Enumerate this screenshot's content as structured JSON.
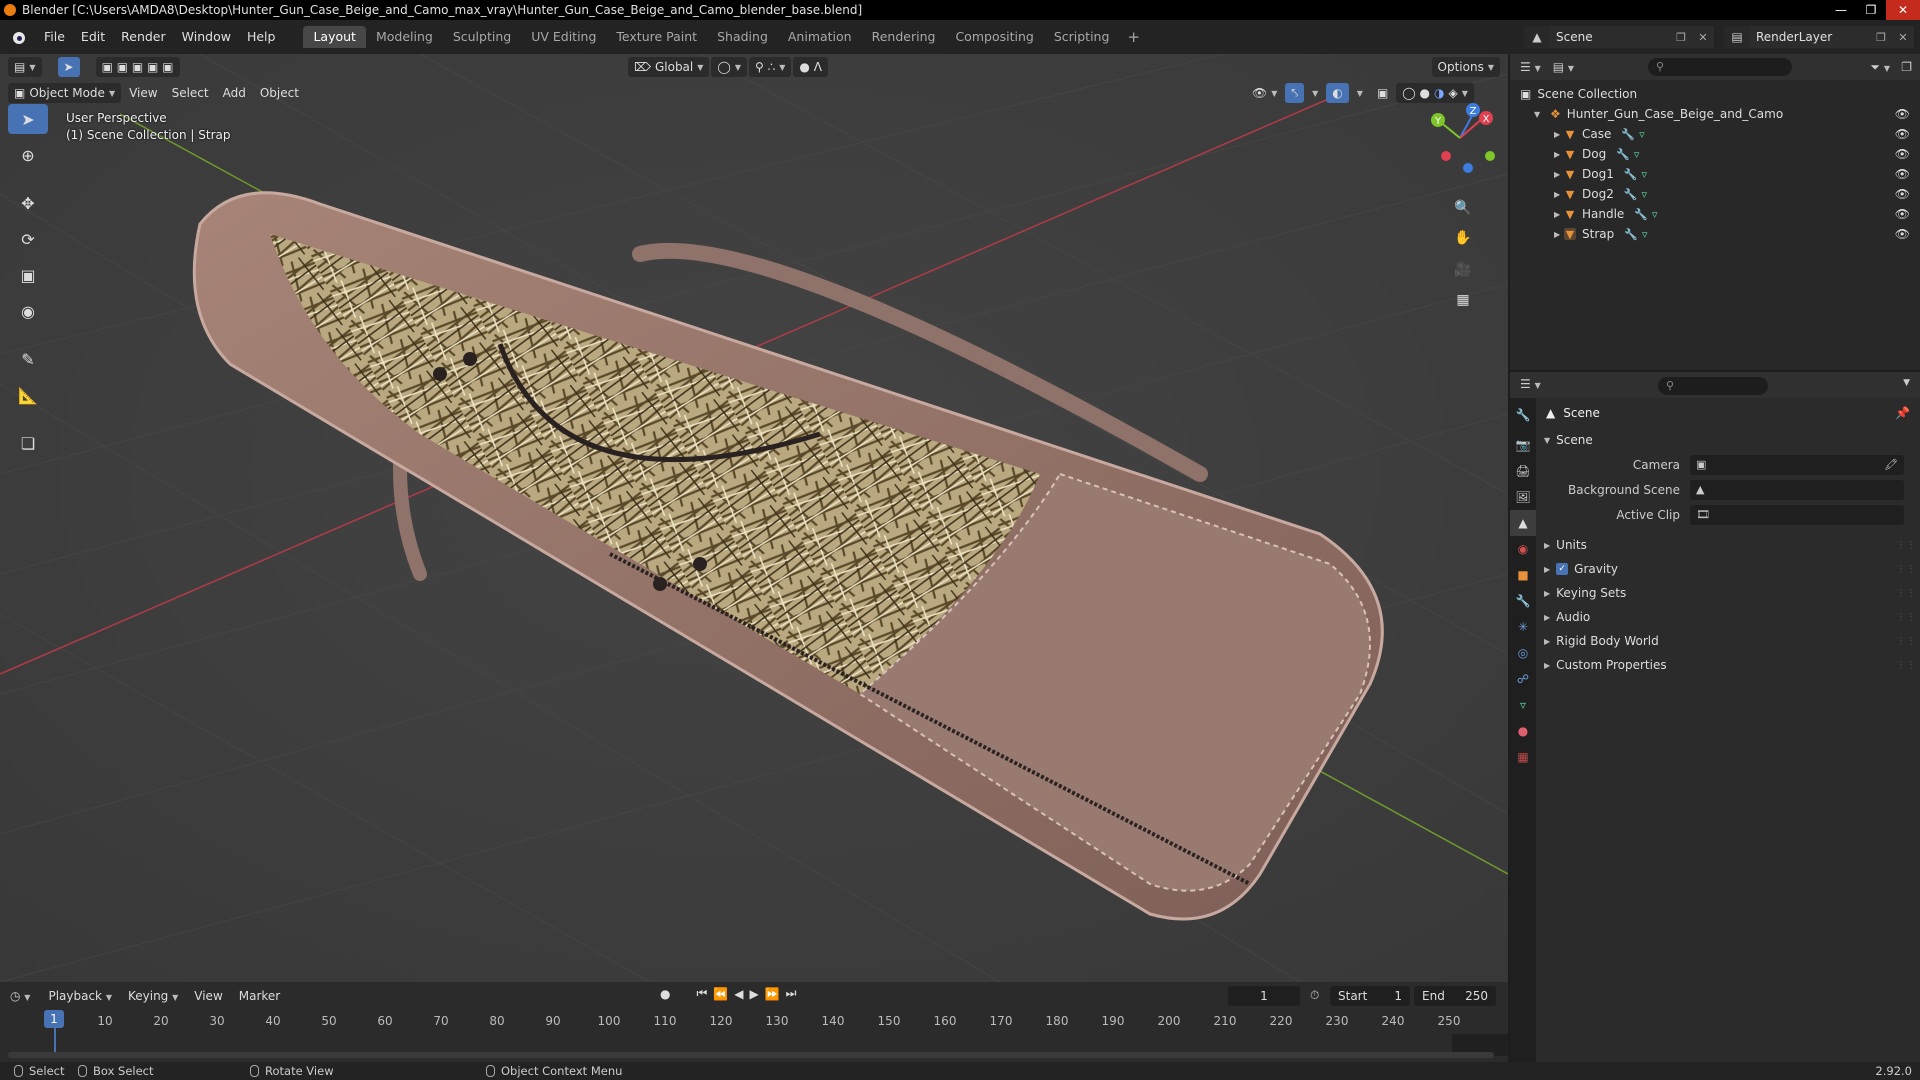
{
  "window": {
    "title": "Blender [C:\\Users\\AMDA8\\Desktop\\Hunter_Gun_Case_Beige_and_Camo_max_vray\\Hunter_Gun_Case_Beige_and_Camo_blender_base.blend]",
    "minimize": "—",
    "maximize": "❐",
    "close": "✕"
  },
  "menu": [
    "File",
    "Edit",
    "Render",
    "Window",
    "Help"
  ],
  "workspaces": [
    "Layout",
    "Modeling",
    "Sculpting",
    "UV Editing",
    "Texture Paint",
    "Shading",
    "Animation",
    "Rendering",
    "Compositing",
    "Scripting"
  ],
  "active_workspace": "Layout",
  "scene_selector": {
    "name": "Scene"
  },
  "view_layer_selector": {
    "name": "RenderLayer"
  },
  "viewport": {
    "mode": "Object Mode",
    "menus": [
      "View",
      "Select",
      "Add",
      "Object"
    ],
    "transform_orientation": "Global",
    "options_label": "Options",
    "info_line1": "User Perspective",
    "info_line2": "(1) Scene Collection | Strap",
    "gizmo_axes": {
      "x": "X",
      "y": "Y",
      "z": "Z"
    }
  },
  "outliner": {
    "root": "Scene Collection",
    "collection": "Hunter_Gun_Case_Beige_and_Camo",
    "objects": [
      "Case",
      "Dog",
      "Dog1",
      "Dog2",
      "Handle",
      "Strap"
    ]
  },
  "properties": {
    "context_title": "Scene",
    "panel_title": "Scene",
    "fields": [
      {
        "label": "Camera",
        "value": ""
      },
      {
        "label": "Background Scene",
        "value": ""
      },
      {
        "label": "Active Clip",
        "value": ""
      }
    ],
    "subpanels": [
      "Units",
      "Gravity",
      "Keying Sets",
      "Audio",
      "Rigid Body World",
      "Custom Properties"
    ],
    "gravity_checked": true
  },
  "timeline": {
    "menus": [
      "Playback",
      "Keying",
      "View",
      "Marker"
    ],
    "current_frame": "1",
    "start_label": "Start",
    "start": "1",
    "end_label": "End",
    "end": "250",
    "ruler": [
      "10",
      "20",
      "30",
      "40",
      "50",
      "60",
      "70",
      "80",
      "90",
      "100",
      "110",
      "120",
      "130",
      "140",
      "150",
      "160",
      "170",
      "180",
      "190",
      "200",
      "210",
      "220",
      "230",
      "240",
      "250"
    ]
  },
  "statusbar": {
    "select": "Select",
    "box_select": "Box Select",
    "rotate_view": "Rotate View",
    "context_menu": "Object Context Menu",
    "version": "2.92.0"
  },
  "colors": {
    "accent": "#4772b3",
    "axis_x": "#e04050",
    "axis_y": "#7ec629",
    "axis_z": "#3d7de0",
    "object_icon": "#e8923b"
  }
}
